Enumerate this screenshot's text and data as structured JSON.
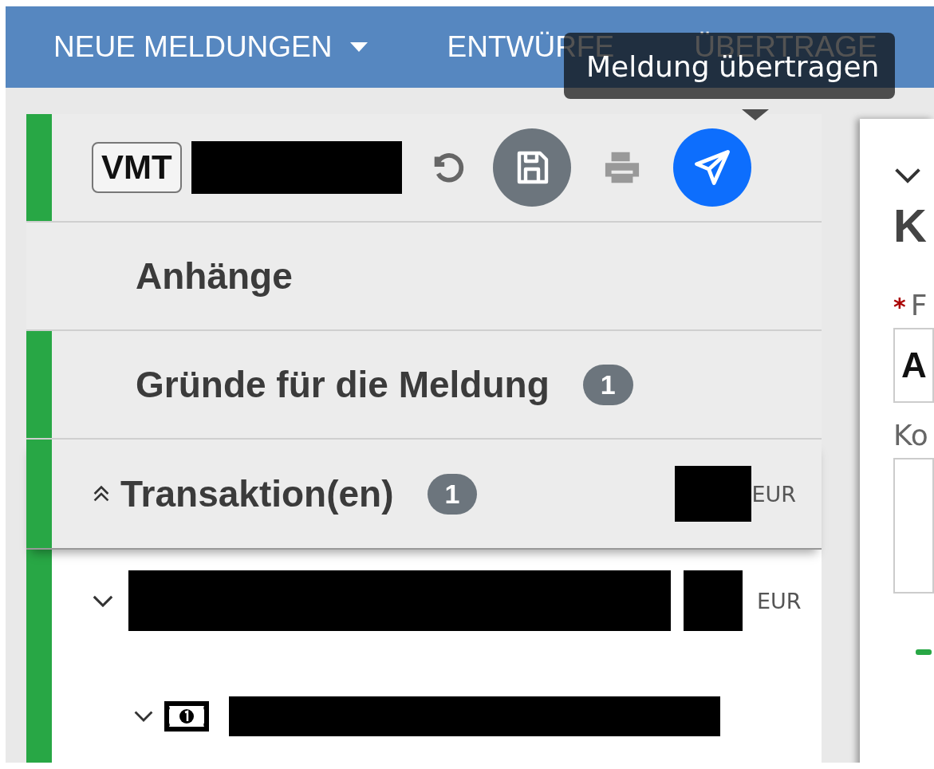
{
  "navbar": {
    "items": [
      {
        "label": "NEUE MELDUNGEN",
        "dropdown": true
      },
      {
        "label": "ENTWÜRFE",
        "dropdown": false
      },
      {
        "label": "ÜBERTRAGE",
        "dropdown": false
      }
    ]
  },
  "tooltip": {
    "text": "Meldung übertragen"
  },
  "header": {
    "badge": "VMT",
    "marked": true
  },
  "sections": [
    {
      "title": "Anhänge",
      "marked": false
    },
    {
      "title": "Gründe für die Meldung",
      "count": "1",
      "marked": true
    },
    {
      "title": "Transaktion(en)",
      "count": "1",
      "currency": "EUR",
      "expanded": true,
      "marked": true
    }
  ],
  "transaction": {
    "currency": "EUR",
    "marked": true
  },
  "detail": {
    "heading": "K",
    "field_label": "F",
    "required_mark": "*",
    "field_value": "A",
    "textarea_label": "Ko"
  }
}
